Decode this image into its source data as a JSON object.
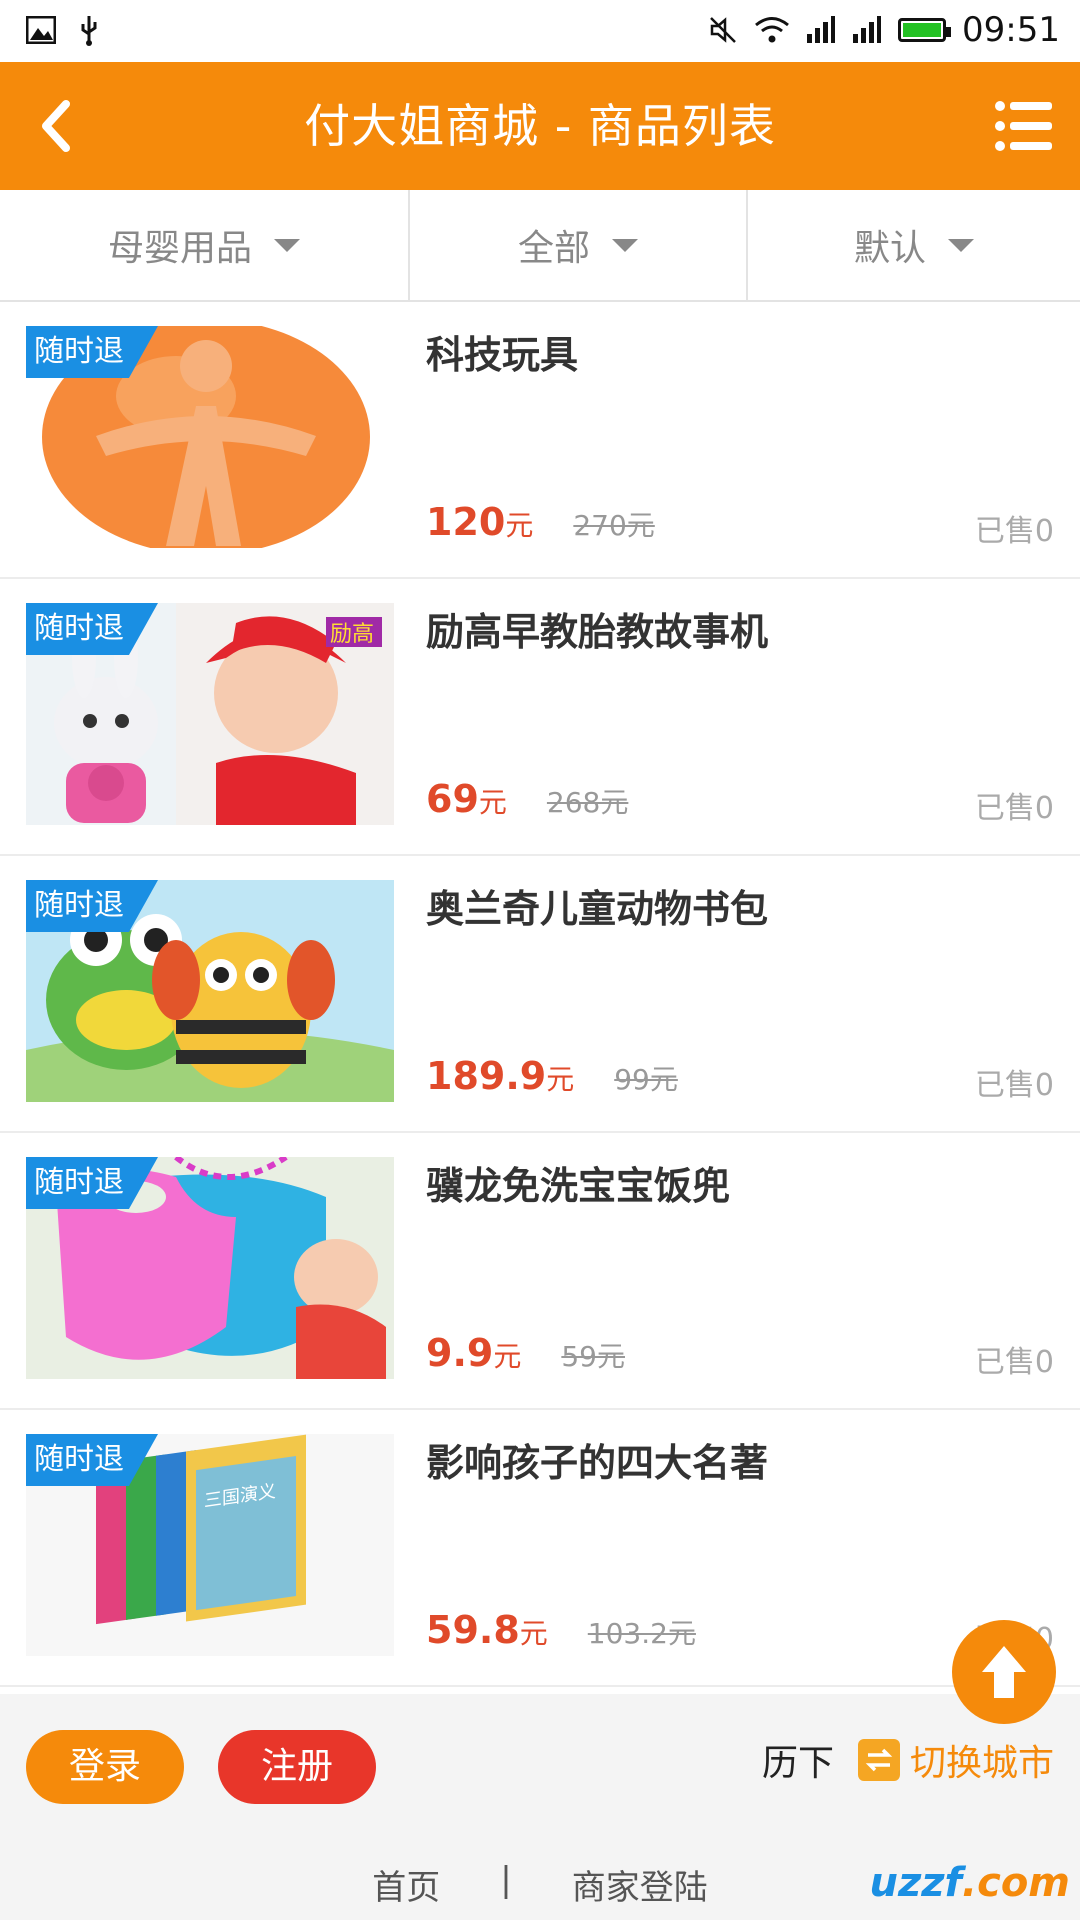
{
  "status_bar": {
    "time": "09:51"
  },
  "header": {
    "title": "付大姐商城 - 商品列表"
  },
  "filters": [
    {
      "label": "母婴用品"
    },
    {
      "label": "全部"
    },
    {
      "label": "默认"
    }
  ],
  "products": [
    {
      "tag": "随时退",
      "name": "科技玩具",
      "price": "120",
      "unit": "元",
      "original_price": "270元",
      "sold": "已售0",
      "image_icon": "orange-logo-image"
    },
    {
      "tag": "随时退",
      "name": "励高早教胎教故事机",
      "price": "69",
      "unit": "元",
      "original_price": "268元",
      "sold": "已售0",
      "image_icon": "baby-story-machine-image"
    },
    {
      "tag": "随时退",
      "name": "奥兰奇儿童动物书包",
      "price": "189.9",
      "unit": "元",
      "original_price": "99元",
      "sold": "已售0",
      "image_icon": "animal-backpack-image"
    },
    {
      "tag": "随时退",
      "name": "骥龙免洗宝宝饭兜",
      "price": "9.9",
      "unit": "元",
      "original_price": "59元",
      "sold": "已售0",
      "image_icon": "baby-bib-image"
    },
    {
      "tag": "随时退",
      "name": "影响孩子的四大名著",
      "price": "59.8",
      "unit": "元",
      "original_price": "103.2元",
      "sold": "已售0",
      "image_icon": "books-image",
      "book_title": "三国演义"
    }
  ],
  "footer": {
    "login_label": "登录",
    "register_label": "注册",
    "current_city": "历下",
    "switch_city_label": "切换城市",
    "links": [
      "首页",
      "商家登陆"
    ],
    "separator": "|",
    "watermark_a": "uzzf",
    "watermark_b": ".com"
  },
  "colors": {
    "brand": "#f58a0b",
    "price": "#e04a2a",
    "tag": "#1a8fe3",
    "register": "#e8362a"
  }
}
